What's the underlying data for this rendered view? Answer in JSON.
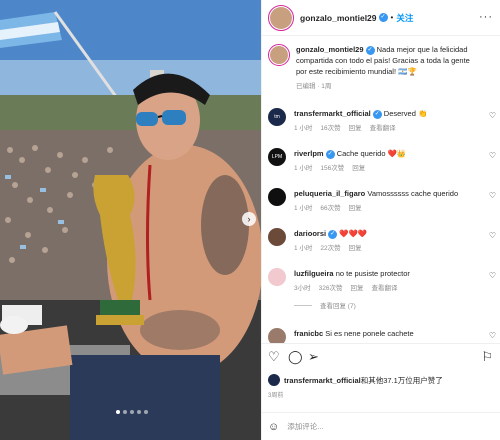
{
  "post": {
    "author": "gonzalo_montiel29",
    "follow_label": "关注",
    "caption": "Nada mejor que la felicidad compartida con todo el país! Gracias a toda la gente por este recibimiento mundial! 🇦🇷🏆",
    "caption_time": "已编辑 · 1周",
    "likes_text": "transfermarkt_official和其他37.1万位用户赞了",
    "likes_user": "transfermarkt_official",
    "likes_rest": "和其他37.1万位用户赞了",
    "time_ago": "3周前"
  },
  "comments": [
    {
      "user": "transfermarkt_official",
      "text": "Deserved 👏",
      "time": "1 小时",
      "likes": "16次赞",
      "reply": "回复",
      "extra": "查看翻译",
      "verified": true,
      "avatar_color": "#1b2a4a"
    },
    {
      "user": "riverlpm",
      "text": "Cache querido ❤️👑",
      "time": "1 小时",
      "likes": "156次赞",
      "reply": "回复",
      "extra": "",
      "verified": true,
      "avatar_color": "#111111"
    },
    {
      "user": "peluqueria_il_figaro",
      "text": "Vamossssss cache querido",
      "time": "1 小时",
      "likes": "66次赞",
      "reply": "回复",
      "extra": "",
      "verified": false,
      "avatar_color": "#0f0f0f"
    },
    {
      "user": "darioorsi",
      "text": "❤️❤️❤️",
      "time": "1 小时",
      "likes": "22次赞",
      "reply": "回复",
      "extra": "",
      "verified": true,
      "avatar_color": "#6b4a3a"
    },
    {
      "user": "luzfilgueira",
      "text": "no te pusiste protector",
      "time": "3小时",
      "likes": "326次赞",
      "reply": "回复",
      "extra": "查看翻译",
      "verified": false,
      "avatar_color": "#f1c9cf"
    },
    {
      "user": "franicbc",
      "text": "Si es nene ponele cachete",
      "time": "",
      "likes": "",
      "reply": "",
      "extra": "",
      "verified": false,
      "avatar_color": "#9a7a6a"
    }
  ],
  "view_replies": "查看回复 (7)",
  "add_comment_placeholder": "添加评论...",
  "icons": {
    "like": "heart-icon",
    "comment": "comment-icon",
    "share": "share-icon",
    "save": "bookmark-icon",
    "emoji": "smile-icon",
    "more": "more-icon",
    "next": "chevron-right-icon"
  },
  "colors": {
    "accent": "#0095f6",
    "verified": "#3897f0",
    "muted": "#8e8e8e"
  }
}
